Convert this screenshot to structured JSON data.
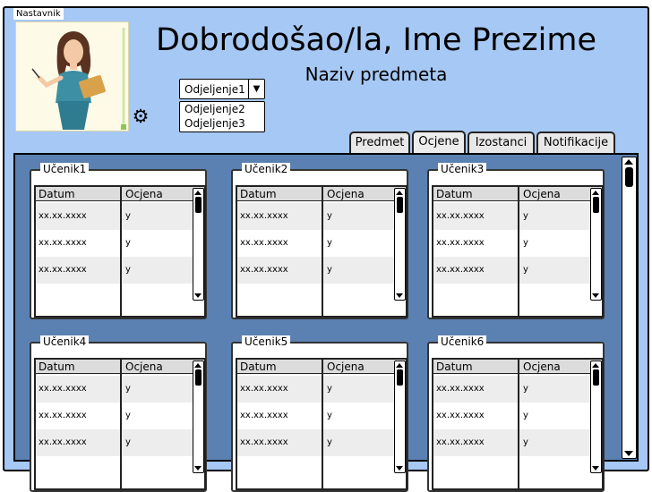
{
  "frame_label": "Nastavnik",
  "header": {
    "title": "Dobrodošao/la, Ime Prezime",
    "subtitle": "Naziv predmeta"
  },
  "settings_icon": "gear-icon",
  "class_select": {
    "selected": "Odjeljenje1",
    "options": [
      "Odjeljenje2",
      "Odjeljenje3"
    ]
  },
  "tabs": [
    {
      "label": "Predmet"
    },
    {
      "label": "Ocjene",
      "active": true
    },
    {
      "label": "Izostanci"
    },
    {
      "label": "Notifikacije"
    }
  ],
  "students": [
    {
      "name": "Učenik1",
      "columns": [
        "Datum",
        "Ocjena"
      ],
      "rows": [
        [
          "xx.xx.xxxx",
          "y"
        ],
        [
          "xx.xx.xxxx",
          "y"
        ],
        [
          "xx.xx.xxxx",
          "y"
        ]
      ]
    },
    {
      "name": "Učenik2",
      "columns": [
        "Datum",
        "Ocjena"
      ],
      "rows": [
        [
          "xx.xx.xxxx",
          "y"
        ],
        [
          "xx.xx.xxxx",
          "y"
        ],
        [
          "xx.xx.xxxx",
          "y"
        ]
      ]
    },
    {
      "name": "Učenik3",
      "columns": [
        "Datum",
        "Ocjena"
      ],
      "rows": [
        [
          "xx.xx.xxxx",
          "y"
        ],
        [
          "xx.xx.xxxx",
          "y"
        ],
        [
          "xx.xx.xxxx",
          "y"
        ]
      ]
    },
    {
      "name": "Učenik4",
      "columns": [
        "Datum",
        "Ocjena"
      ],
      "rows": [
        [
          "xx.xx.xxxx",
          "y"
        ],
        [
          "xx.xx.xxxx",
          "y"
        ],
        [
          "xx.xx.xxxx",
          "y"
        ]
      ]
    },
    {
      "name": "Učenik5",
      "columns": [
        "Datum",
        "Ocjena"
      ],
      "rows": [
        [
          "xx.xx.xxxx",
          "y"
        ],
        [
          "xx.xx.xxxx",
          "y"
        ],
        [
          "xx.xx.xxxx",
          "y"
        ]
      ]
    },
    {
      "name": "Učenik6",
      "columns": [
        "Datum",
        "Ocjena"
      ],
      "rows": [
        [
          "xx.xx.xxxx",
          "y"
        ],
        [
          "xx.xx.xxxx",
          "y"
        ],
        [
          "xx.xx.xxxx",
          "y"
        ]
      ]
    }
  ],
  "colors": {
    "background": "#a6c8f4",
    "panel": "#5b81b2",
    "header_row": "#dcdcdc",
    "alt_row": "#ededed"
  }
}
